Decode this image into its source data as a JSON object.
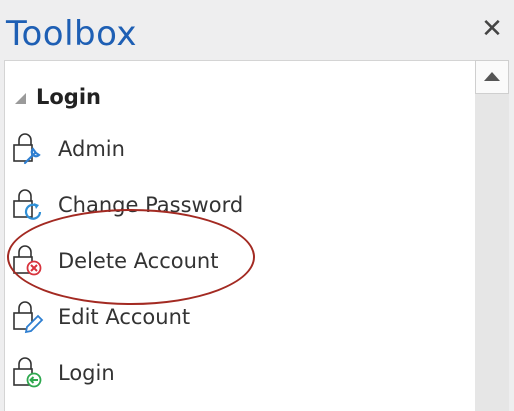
{
  "window": {
    "title": "Toolbox",
    "close_glyph": "✕"
  },
  "category": {
    "label": "Login",
    "expanded": true
  },
  "items": [
    {
      "label": "Admin",
      "icon": "lock-wrench-icon",
      "badge_color": "#2f7fd1"
    },
    {
      "label": "Change Password",
      "icon": "lock-refresh-icon",
      "badge_color": "#2f8fd6"
    },
    {
      "label": "Delete Account",
      "icon": "lock-delete-icon",
      "badge_color": "#d8323c"
    },
    {
      "label": "Edit Account",
      "icon": "lock-pencil-icon",
      "badge_color": "#2f7fd1"
    },
    {
      "label": "Login",
      "icon": "lock-login-icon",
      "badge_color": "#2ea84e"
    }
  ],
  "highlight": {
    "target": "Delete Account",
    "color": "#a32a22"
  }
}
